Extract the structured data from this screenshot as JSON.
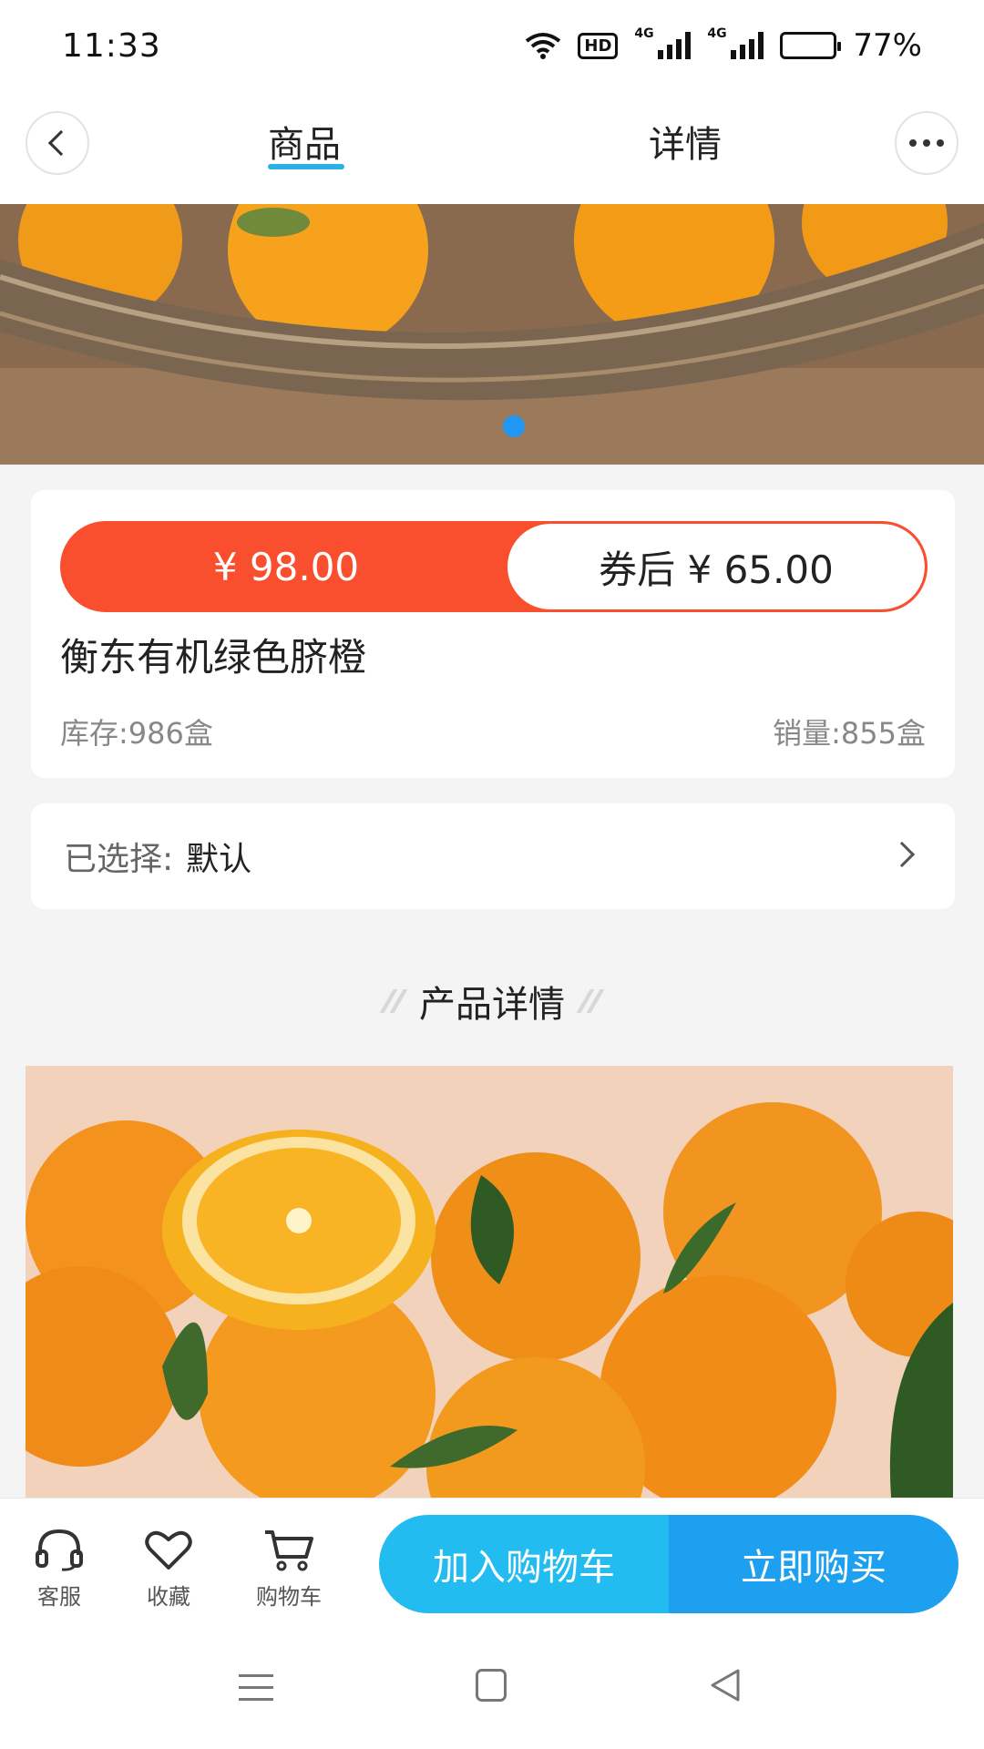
{
  "status_bar": {
    "time": "11:33",
    "hd": "HD",
    "net1": "4G",
    "net2": "4G",
    "battery": "77%"
  },
  "nav": {
    "tabs": [
      {
        "label": "商品"
      },
      {
        "label": "详情"
      }
    ]
  },
  "product": {
    "original_price": "¥ 98.00",
    "coupon_price": "券后 ¥ 65.00",
    "title": "衡东有机绿色脐橙",
    "stock": "库存:986盒",
    "sales": "销量:855盒"
  },
  "spec": {
    "label": "已选择:",
    "value": "默认"
  },
  "section": {
    "title": "产品详情"
  },
  "actions": {
    "service": "客服",
    "favorite": "收藏",
    "cart": "购物车",
    "add_to_cart": "加入购物车",
    "buy_now": "立即购买"
  },
  "colors": {
    "accent": "#2ab0e4",
    "price_red": "#fa4f2e",
    "cta_light": "#22bcf1",
    "cta_dark": "#1ea0f0"
  }
}
